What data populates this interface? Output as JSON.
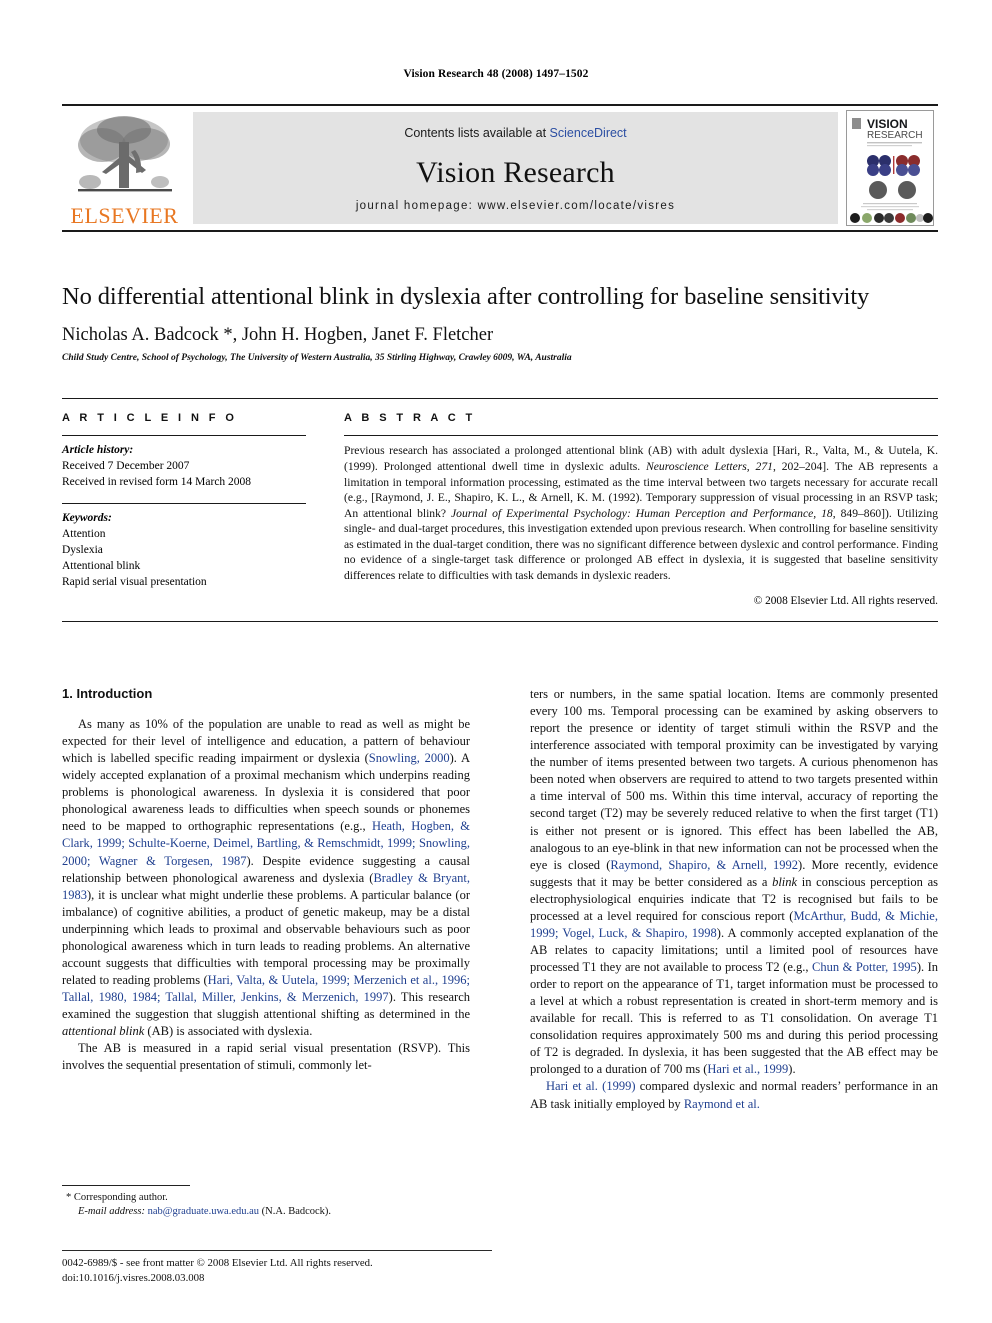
{
  "running_head": "Vision Research 48 (2008) 1497–1502",
  "masthead": {
    "publisher_name": "ELSEVIER",
    "contents_prefix": "Contents lists available at ",
    "contents_link": "ScienceDirect",
    "journal_title": "Vision Research",
    "homepage": "journal homepage: www.elsevier.com/locate/visres",
    "cover_title_line1": "VISION",
    "cover_title_line2": "RESEARCH"
  },
  "article": {
    "title": "No differential attentional blink in dyslexia after controlling for baseline sensitivity",
    "authors": "Nicholas A. Badcock *, John H. Hogben, Janet F. Fletcher",
    "affiliation": "Child Study Centre, School of Psychology, The University of Western Australia, 35 Stirling Highway, Crawley 6009, WA, Australia"
  },
  "article_info": {
    "heading": "A R T I C L E  I N F O",
    "history_label": "Article history:",
    "history": [
      "Received 7 December 2007",
      "Received in revised form 14 March 2008"
    ],
    "keywords_label": "Keywords:",
    "keywords": [
      "Attention",
      "Dyslexia",
      "Attentional blink",
      "Rapid serial visual presentation"
    ]
  },
  "abstract": {
    "heading": "A B S T R A C T",
    "p1_a": "Previous research has associated a prolonged attentional blink (AB) with adult dyslexia [Hari, R., Valta, M., & Uutela, K. (1999). Prolonged attentional dwell time in dyslexic adults. ",
    "p1_italic1": "Neuroscience Letters, 271",
    "p1_b": ", 202–204]. The AB represents a limitation in temporal information processing, estimated as the time interval between two targets necessary for accurate recall (e.g., [Raymond, J. E., Shapiro, K. L., & Arnell, K. M. (1992). Temporary suppression of visual processing in an RSVP task; An attentional blink? ",
    "p1_italic2": "Journal of Experimental Psychology: Human Perception and Performance, 18",
    "p1_c": ", 849–860]). Utilizing single- and dual-target procedures, this investigation extended upon previous research. When controlling for baseline sensitivity as estimated in the dual-target condition, there was no significant difference between dyslexic and control performance. Finding no evidence of a single-target task difference or prolonged AB effect in dyslexia, it is suggested that baseline sensitivity differences relate to difficulties with task demands in dyslexic readers.",
    "copyright": "© 2008 Elsevier Ltd. All rights reserved."
  },
  "body": {
    "section_heading": "1. Introduction",
    "left": {
      "p1_a": "As many as 10% of the population are unable to read as well as might be expected for their level of intelligence and education, a pattern of behaviour which is labelled specific reading impairment or dyslexia (",
      "p1_cite1": "Snowling, 2000",
      "p1_b": "). A widely accepted explanation of a proximal mechanism which underpins reading problems is phonological awareness. In dyslexia it is considered that poor phonological awareness leads to difficulties when speech sounds or phonemes need to be mapped to orthographic representations (e.g., ",
      "p1_cite2": "Heath, Hogben, & Clark, 1999; Schulte-Koerne, Deimel, Bartling, & Remschmidt, 1999; Snowling, 2000; Wagner & Torgesen, 1987",
      "p1_c": "). Despite evidence suggesting a causal relationship between phonological awareness and dyslexia (",
      "p1_cite3": "Bradley & Bryant, 1983",
      "p1_d": "), it is unclear what might underlie these problems. A particular balance (or imbalance) of cognitive abilities, a product of genetic makeup, may be a distal underpinning which leads to proximal and observable behaviours such as poor phonological awareness which in turn leads to reading problems. An alternative account suggests that difficulties with temporal processing may be proximally related to reading problems (",
      "p1_cite4": "Hari, Valta, & Uutela, 1999; Merzenich et al., 1996; Tallal, 1980, 1984; Tallal, Miller, Jenkins, & Merzenich, 1997",
      "p1_e": "). This research examined the suggestion that sluggish attentional shifting as determined in the ",
      "p1_italic": "attentional blink",
      "p1_f": " (AB) is associated with dyslexia.",
      "p2": "The AB is measured in a rapid serial visual presentation (RSVP). This involves the sequential presentation of stimuli, commonly let-"
    },
    "right": {
      "p1_a": "ters or numbers, in the same spatial location. Items are commonly presented every 100 ms. Temporal processing can be examined by asking observers to report the presence or identity of target stimuli within the RSVP and the interference associated with temporal proximity can be investigated by varying the number of items presented between two targets. A curious phenomenon has been noted when observers are required to attend to two targets presented within a time interval of 500 ms. Within this time interval, accuracy of reporting the second target (T2) may be severely reduced relative to when the first target (T1) is either not present or is ignored. This effect has been labelled the AB, analogous to an eye-blink in that new information can not be processed when the eye is closed (",
      "p1_cite1": "Raymond, Shapiro, & Arnell, 1992",
      "p1_b": "). More recently, evidence suggests that it may be better considered as a ",
      "p1_italic1": "blink",
      "p1_c": " in conscious perception as electrophysiological enquiries indicate that T2 is recognised but fails to be processed at a level required for conscious report (",
      "p1_cite2": "McArthur, Budd, & Michie, 1999; Vogel, Luck, & Shapiro, 1998",
      "p1_d": "). A commonly accepted explanation of the AB relates to capacity limitations; until a limited pool of resources have processed T1 they are not available to process T2 (e.g., ",
      "p1_cite3": "Chun & Potter, 1995",
      "p1_e": "). In order to report on the appearance of T1, target information must be processed to a level at which a robust representation is created in short-term memory and is available for recall. This is referred to as T1 consolidation. On average T1 consolidation requires approximately 500 ms and during this period processing of T2 is degraded. In dyslexia, it has been suggested that the AB effect may be prolonged to a duration of 700 ms (",
      "p1_cite4": "Hari et al., 1999",
      "p1_f": ").",
      "p2_cite": "Hari et al. (1999)",
      "p2_a": " compared dyslexic and normal readers’ performance in an AB task initially employed by ",
      "p2_cite2": "Raymond et al."
    }
  },
  "footnotes": {
    "corresponding": "Corresponding author.",
    "email_label": "E-mail address:",
    "email": "nab@graduate.uwa.edu.au",
    "email_suffix": "(N.A. Badcock).",
    "issn_line": "0042-6989/$ - see front matter © 2008 Elsevier Ltd. All rights reserved.",
    "doi_line": "doi:10.1016/j.visres.2008.03.008"
  },
  "colors": {
    "link": "#2b4ea2",
    "citation": "#1f3f8f",
    "elsevier_orange": "#E87722",
    "masthead_grey": "#e3e3e3"
  }
}
